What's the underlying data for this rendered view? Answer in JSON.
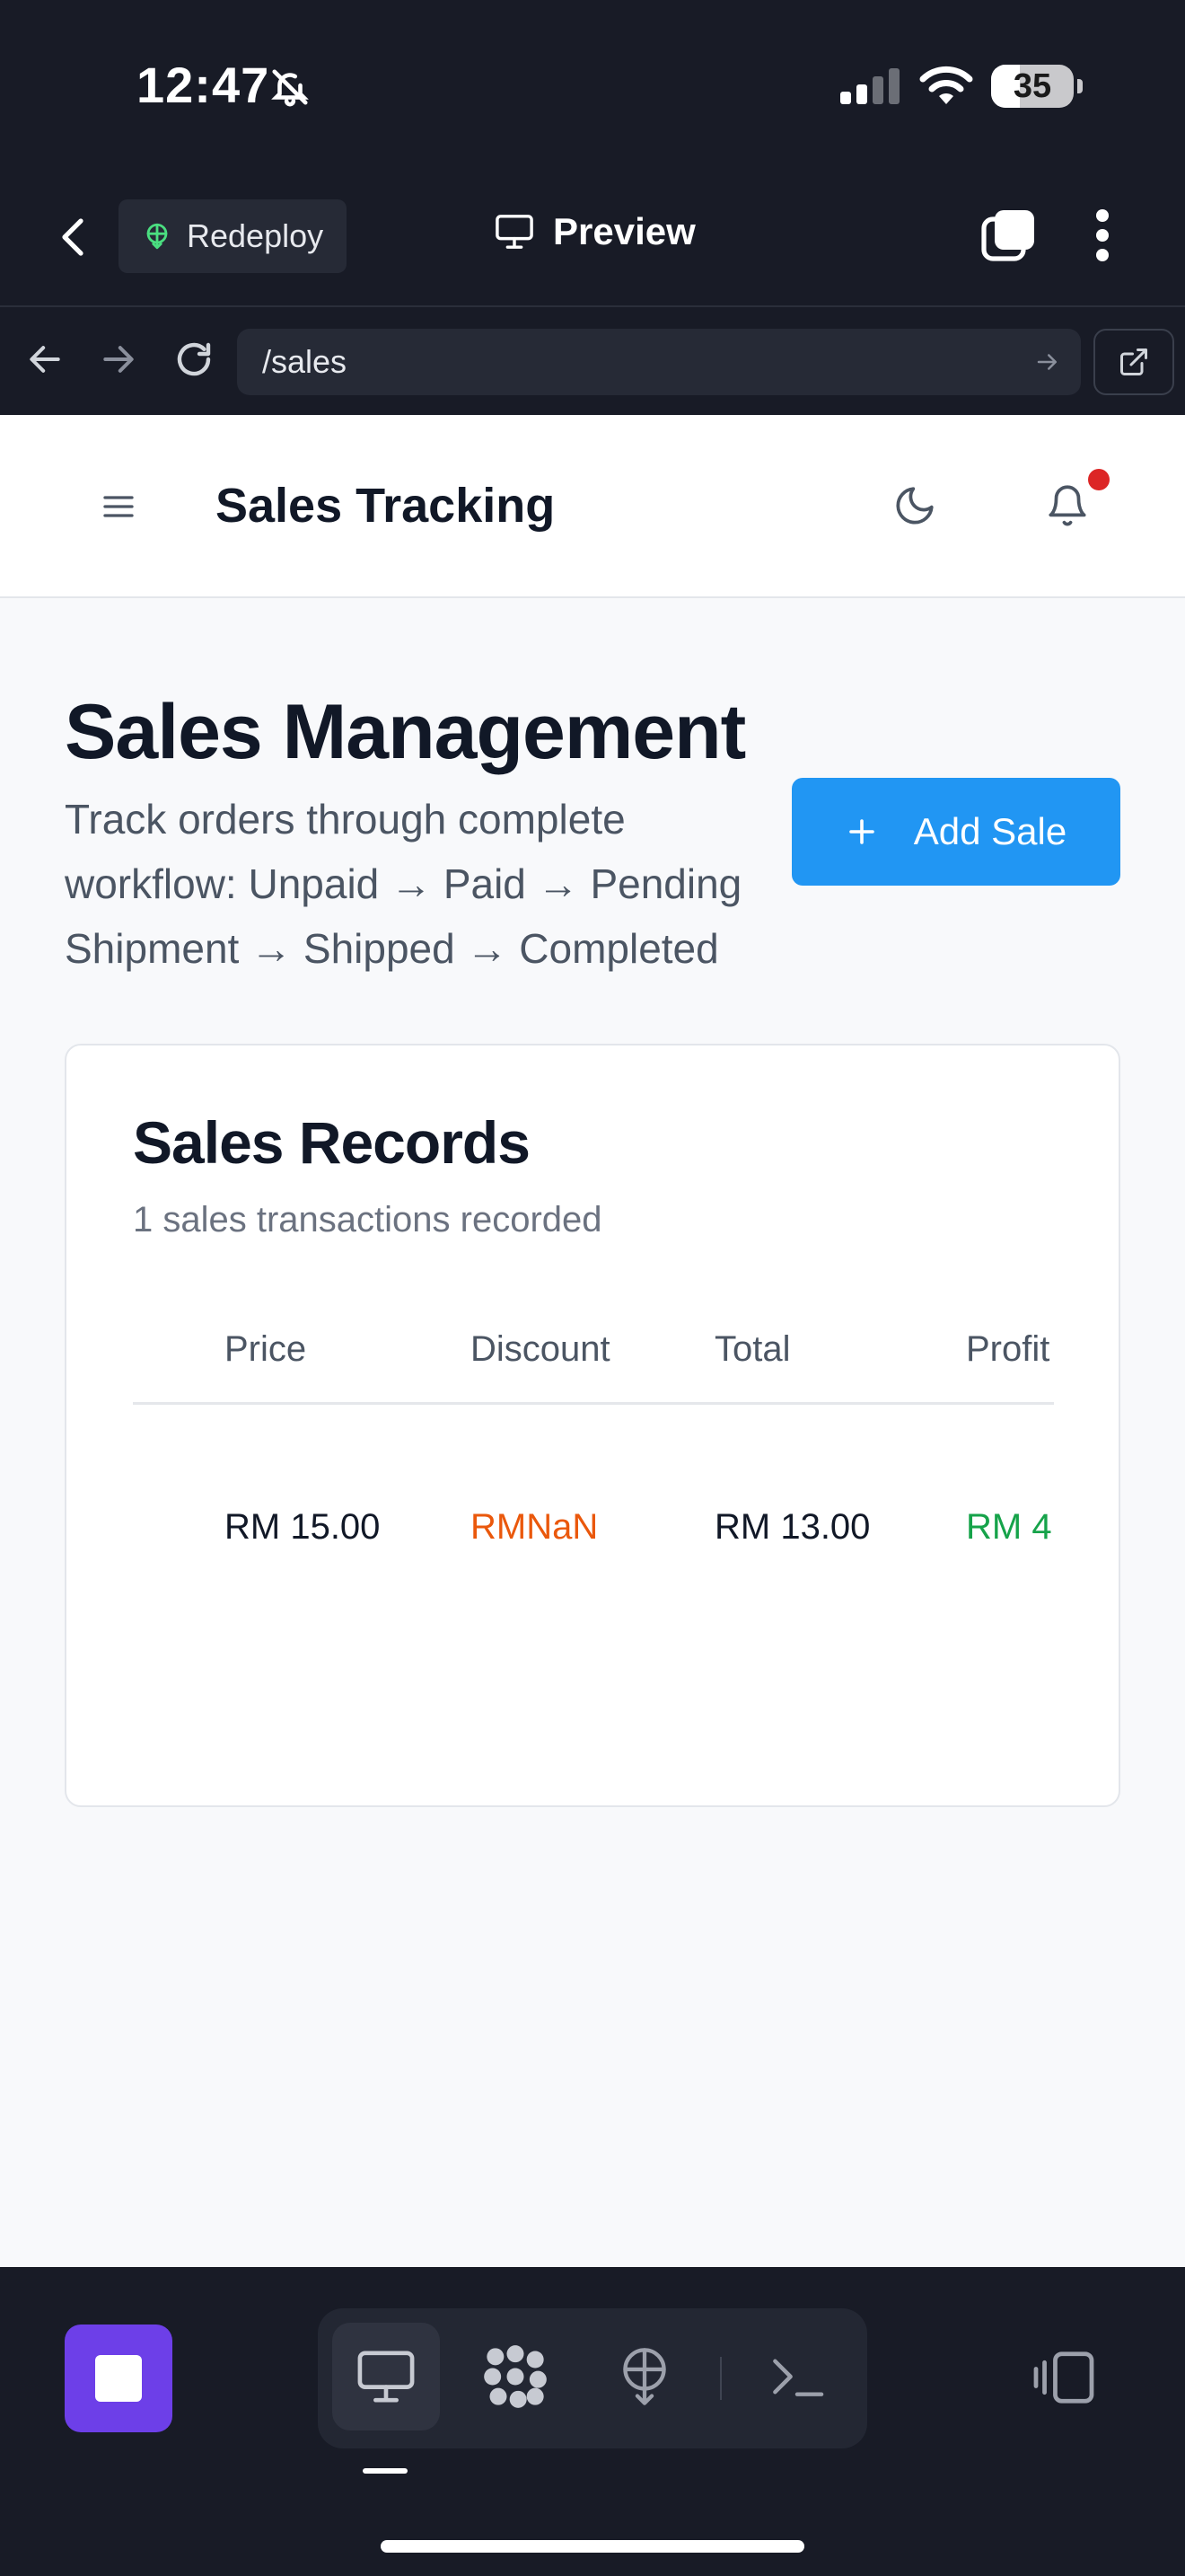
{
  "status": {
    "time": "12:47",
    "battery": "35",
    "battery_level": 0.35
  },
  "appbar": {
    "redeploy_label": "Redeploy",
    "preview_label": "Preview"
  },
  "browser": {
    "url": "/sales"
  },
  "header": {
    "title": "Sales Tracking"
  },
  "page": {
    "title": "Sales Management",
    "description": "Track orders through complete workflow: Unpaid → Paid → Pending Shipment → Shipped → Completed",
    "add_button_label": "Add Sale"
  },
  "records": {
    "title": "Sales Records",
    "subtitle": "1 sales transactions recorded",
    "columns": [
      "Price",
      "Discount",
      "Total",
      "Profit"
    ],
    "rows": [
      {
        "price": "RM 15.00",
        "discount": "RMNaN",
        "total": "RM 13.00",
        "profit": "RM 4"
      }
    ]
  },
  "colors": {
    "accent": "#2196f3",
    "discount": "#ea580c",
    "profit": "#16a34a",
    "stop": "#6d3fe8"
  }
}
